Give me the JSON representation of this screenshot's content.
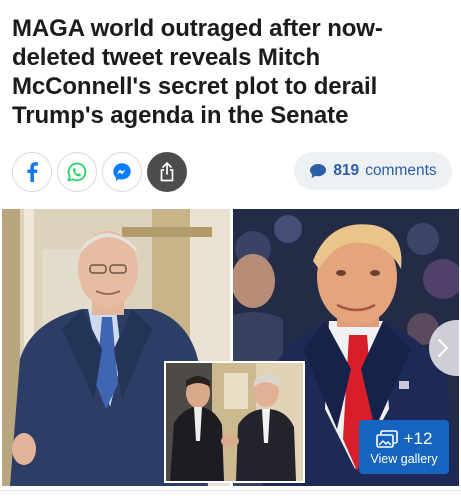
{
  "article": {
    "headline": "MAGA world outraged after now-deleted tweet reveals Mitch McConnell's secret plot to derail Trump's agenda in the Senate"
  },
  "share": {
    "buttons": [
      {
        "icon": "facebook-icon",
        "color": "#1877f2"
      },
      {
        "icon": "whatsapp-icon",
        "color": "#25d366"
      },
      {
        "icon": "messenger-icon",
        "color": "#0a7cff"
      },
      {
        "icon": "share-icon",
        "color": "#ffffff"
      }
    ]
  },
  "comments": {
    "count": "819",
    "label": "comments",
    "icon": "speech-bubble-icon",
    "color": "#2b5ea7"
  },
  "gallery": {
    "extra_count": "+12",
    "view_label": "View gallery",
    "icon": "image-stack-icon",
    "accent": "#1565c0",
    "next_icon": "chevron-right-icon"
  }
}
